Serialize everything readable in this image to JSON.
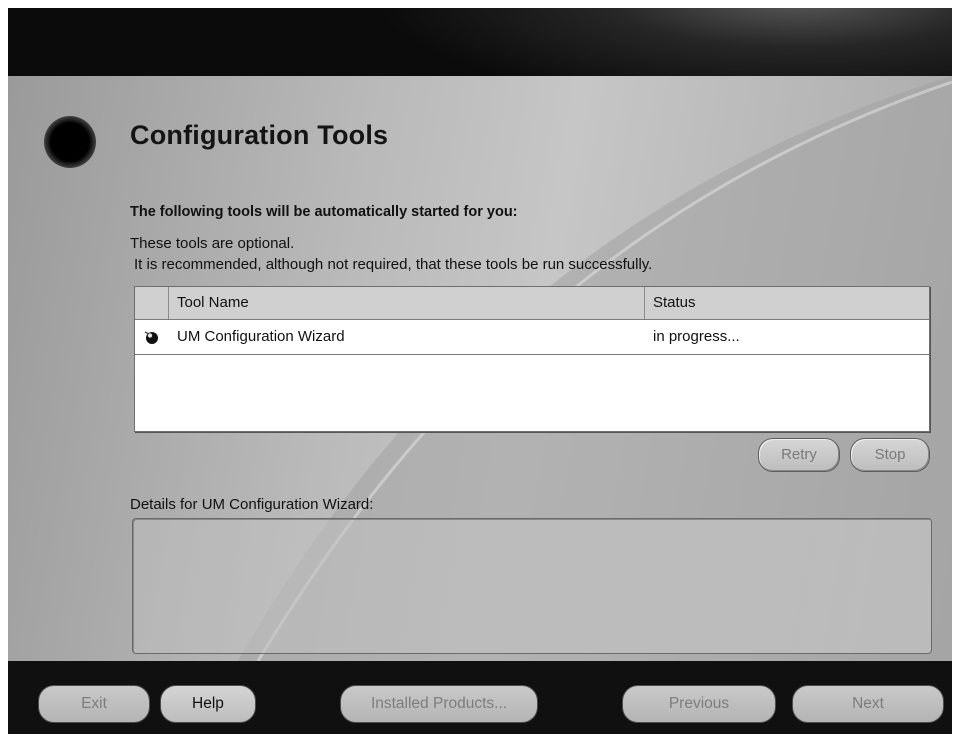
{
  "page": {
    "title": "Configuration Tools",
    "subtitle": "The following tools will be automatically started for you:",
    "description_1": "These tools are optional.",
    "description_2": "It is recommended, although not required, that these tools be run successfully."
  },
  "tools_table": {
    "columns": [
      "Tool Name",
      "Status"
    ],
    "rows": [
      {
        "icon": "running-tool-icon",
        "name": "UM Configuration Wizard",
        "status": "in progress..."
      }
    ]
  },
  "table_actions": {
    "retry_label": "Retry",
    "stop_label": "Stop"
  },
  "details": {
    "label": "Details for UM Configuration Wizard:",
    "content": ""
  },
  "footer": {
    "exit_label": "Exit",
    "help_label": "Help",
    "installed_products_label": "Installed Products...",
    "previous_label": "Previous",
    "next_label": "Next"
  },
  "colors": {
    "banner": "#0e0e0e",
    "panel": "#b4b4b4",
    "button": "#c8c8c8",
    "disabled_text": "#7a7a7a"
  }
}
